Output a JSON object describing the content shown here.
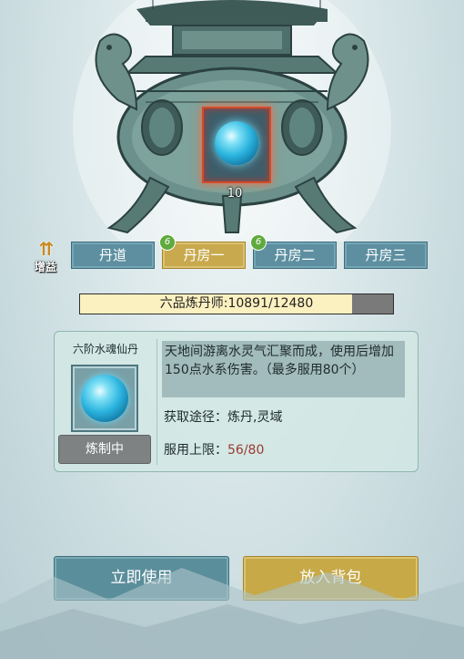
{
  "boost": {
    "label": "增益",
    "icon": "up-arrows-icon"
  },
  "pill_slot": {
    "count": "10",
    "icon": "water-pill-orb-icon"
  },
  "tabs": [
    {
      "label": "丹道",
      "badge": "",
      "active": false
    },
    {
      "label": "丹房一",
      "badge": "6",
      "active": true
    },
    {
      "label": "丹房二",
      "badge": "6",
      "active": false
    },
    {
      "label": "丹房三",
      "badge": "",
      "active": false
    }
  ],
  "rank": {
    "text": "六品炼丹师:10891/12480",
    "current": 10891,
    "max": 12480,
    "fraction": 0.87
  },
  "item": {
    "name": "六阶水魂仙丹",
    "status_label": "炼制中",
    "description": "天地间游离水灵气汇聚而成，使用后增加150点水系伤害。（最多服用80个）",
    "acquire_label": "获取途径：炼丹,灵域",
    "limit_label": "服用上限：",
    "limit_value": "56/80"
  },
  "actions": {
    "use_label": "立即使用",
    "bag_label": "放入背包"
  },
  "colors": {
    "tab_active": "#c8a94d",
    "tab_inactive": "#5d8fa0",
    "badge_green": "#5faa3e",
    "slot_highlight": "#d24b2c",
    "limit_value": "#9a3a32"
  }
}
